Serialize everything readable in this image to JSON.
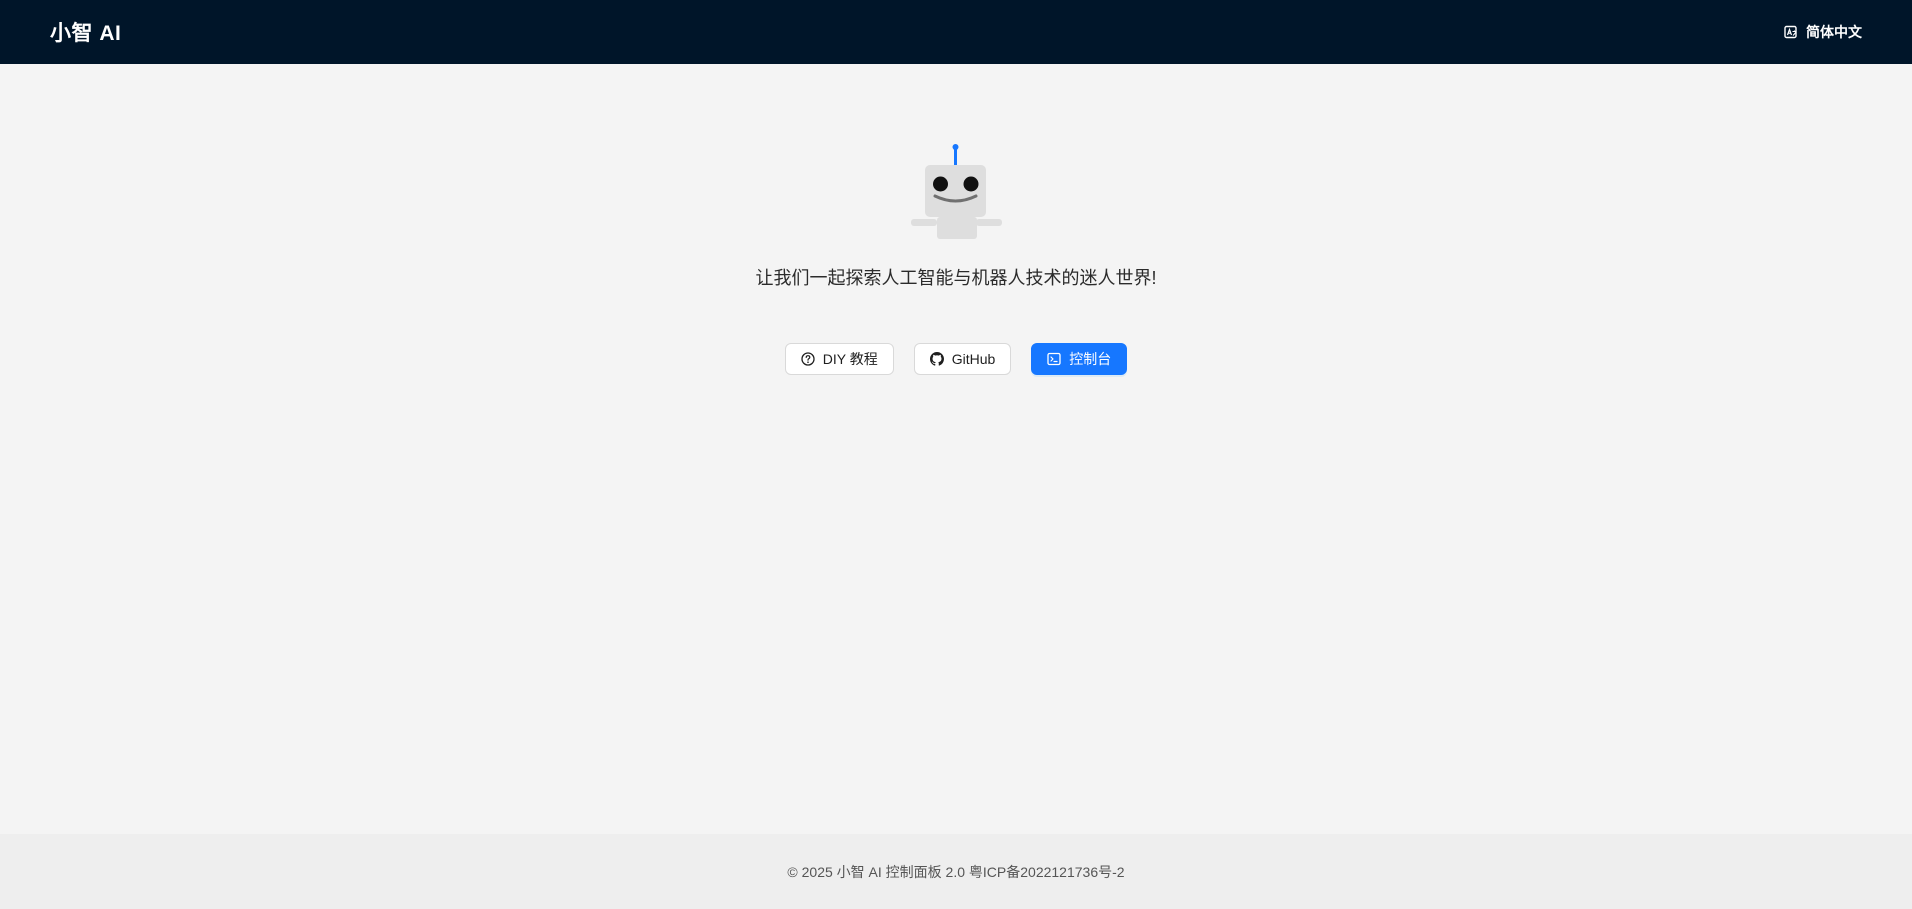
{
  "header": {
    "brand": "小智 AI",
    "language_icon": "translate-icon",
    "language_label": "简体中文"
  },
  "main": {
    "illustration_icon": "robot-icon",
    "slogan": "让我们一起探索人工智能与机器人技术的迷人世界!",
    "buttons": [
      {
        "icon": "question-circle-icon",
        "label": "DIY 教程",
        "type": "default"
      },
      {
        "icon": "github-icon",
        "label": "GitHub",
        "type": "default"
      },
      {
        "icon": "console-icon",
        "label": "控制台",
        "type": "primary"
      }
    ]
  },
  "footer": {
    "copyright": "© 2025 小智 AI 控制面板 2.0 粤ICP备2022121736号-2"
  },
  "colors": {
    "header_bg": "#001529",
    "primary": "#1677ff",
    "antenna": "#1677ff",
    "page_bg": "#f4f4f4"
  }
}
